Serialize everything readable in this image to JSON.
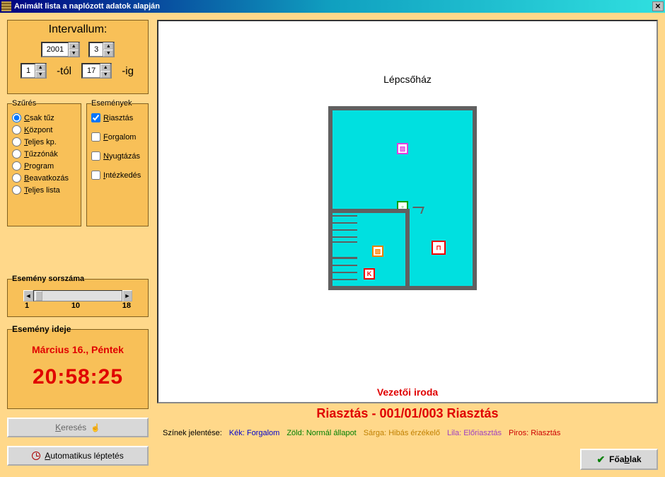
{
  "window": {
    "title": "Animált lista a naplózott adatok alapján"
  },
  "interval": {
    "title": "Intervallum:",
    "year": "2001",
    "month": "3",
    "from_day": "1",
    "from_suffix": "-tól",
    "to_day": "17",
    "to_suffix": "-ig"
  },
  "filter": {
    "legend": "Szűrés",
    "items": [
      {
        "label": "Csak tűz",
        "checked": true
      },
      {
        "label": "Központ",
        "checked": false
      },
      {
        "label": "Teljes kp.",
        "checked": false
      },
      {
        "label": "Tűzzónák",
        "checked": false
      },
      {
        "label": "Program",
        "checked": false
      },
      {
        "label": "Beavatkozás",
        "checked": false
      },
      {
        "label": "Teljes lista",
        "checked": false
      }
    ]
  },
  "events": {
    "legend": "Események",
    "items": [
      {
        "label": "Riasztás",
        "checked": true
      },
      {
        "label": "Forgalom",
        "checked": false
      },
      {
        "label": "Nyugtázás",
        "checked": false
      },
      {
        "label": "Intézkedés",
        "checked": false
      }
    ]
  },
  "sequence": {
    "title": "Esemény sorszáma",
    "min": "1",
    "mid": "10",
    "max": "18"
  },
  "event_time": {
    "title": "Esemény ideje",
    "date": "Március 16., Péntek",
    "time": "20:58:25"
  },
  "buttons": {
    "search": "Keresés",
    "auto_step": "Automatikus léptetés",
    "main_window": "Főablak"
  },
  "floorplan": {
    "title": "Lépcsőház",
    "room_label": "Vezetői iroda"
  },
  "alarm": {
    "text": "Riasztás - 001/01/003  Riasztás"
  },
  "legend": {
    "title": "Színek jelentése:",
    "blue": "Kék: Forgalom",
    "green": "Zöld: Normál állapot",
    "orange": "Sárga: Hibás érzékelő",
    "lila": "Lila: Előriasztás",
    "red": "Piros: Riasztás"
  }
}
